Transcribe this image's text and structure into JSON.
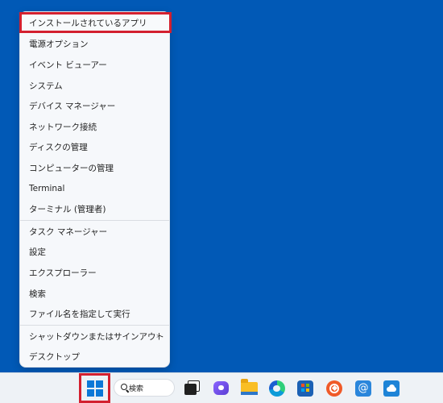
{
  "menu": {
    "items": [
      {
        "label": "インストールされているアプリ"
      },
      {
        "label": "電源オプション"
      },
      {
        "label": "イベント ビューアー"
      },
      {
        "label": "システム"
      },
      {
        "label": "デバイス マネージャー"
      },
      {
        "label": "ネットワーク接続"
      },
      {
        "label": "ディスクの管理"
      },
      {
        "label": "コンピューターの管理"
      },
      {
        "label": "Terminal"
      },
      {
        "label": "ターミナル (管理者)"
      },
      {
        "label": "タスク マネージャー"
      },
      {
        "label": "設定"
      },
      {
        "label": "エクスプローラー"
      },
      {
        "label": "検索"
      },
      {
        "label": "ファイル名を指定して実行"
      },
      {
        "label": "シャットダウンまたはサインアウト",
        "submenu_arrow": "›"
      },
      {
        "label": "デスクトップ"
      }
    ]
  },
  "taskbar": {
    "search_label": "検索",
    "mail_glyph": "@"
  },
  "colors": {
    "desktop": "#0159b6",
    "highlight": "#d3202f",
    "menu_background": "#f6f8fb",
    "taskbar": "#eef2f6"
  }
}
